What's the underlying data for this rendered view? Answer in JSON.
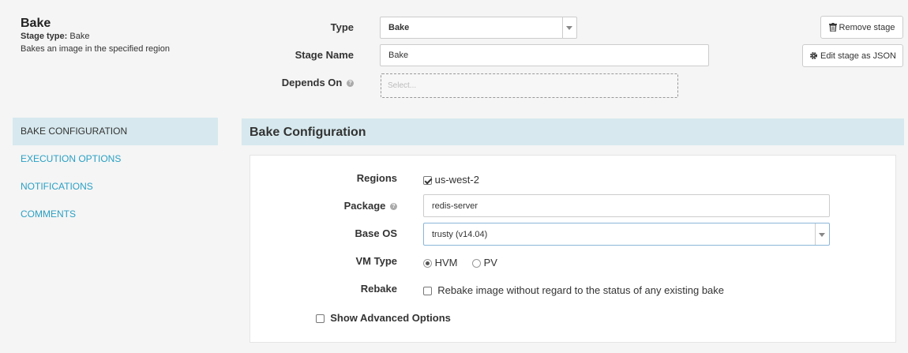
{
  "header": {
    "title": "Bake",
    "stage_type_label": "Stage type:",
    "stage_type_value": "Bake",
    "description": "Bakes an image in the specified region"
  },
  "stage_form": {
    "type_label": "Type",
    "type_value": "Bake",
    "name_label": "Stage Name",
    "name_value": "Bake",
    "depends_label": "Depends On",
    "depends_placeholder": "Select..."
  },
  "actions": {
    "remove_label": "Remove stage",
    "edit_json_label": "Edit stage as JSON"
  },
  "side_nav": {
    "items": [
      {
        "label": "BAKE CONFIGURATION"
      },
      {
        "label": "EXECUTION OPTIONS"
      },
      {
        "label": "NOTIFICATIONS"
      },
      {
        "label": "COMMENTS"
      }
    ]
  },
  "bake": {
    "section_title": "Bake Configuration",
    "regions_label": "Regions",
    "region_value": "us-west-2",
    "package_label": "Package",
    "package_value": "redis-server",
    "base_os_label": "Base OS",
    "base_os_value": "trusty (v14.04)",
    "vm_type_label": "VM Type",
    "vm_option_hvm": "HVM",
    "vm_option_pv": "PV",
    "rebake_label": "Rebake",
    "rebake_text": "Rebake image without regard to the status of any existing bake",
    "advanced_label": "Show Advanced Options"
  },
  "colors": {
    "accent": "#2aa0c4",
    "section_bg": "#d7e9ee",
    "page_bg": "#f5f5f5"
  },
  "icons": {
    "help": "question-circle-icon",
    "trash": "trash-icon",
    "gear": "gear-icon",
    "dropdown": "chevron-down-icon"
  }
}
